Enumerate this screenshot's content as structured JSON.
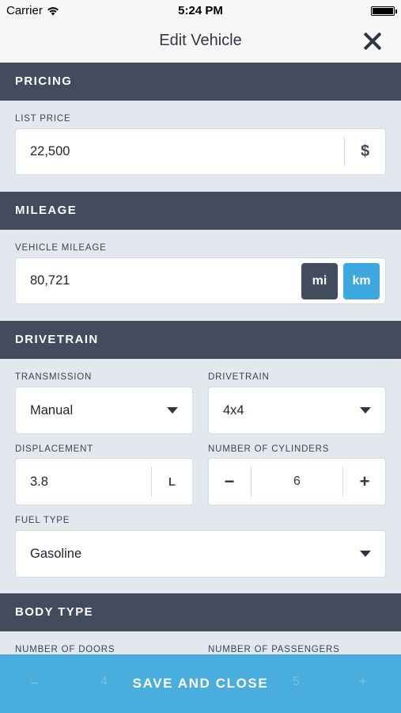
{
  "status": {
    "carrier": "Carrier",
    "time": "5:24 PM"
  },
  "header": {
    "title": "Edit Vehicle",
    "close_icon": "close-icon"
  },
  "pricing": {
    "heading": "PRICING",
    "list_price_label": "LIST PRICE",
    "list_price_value": "22,500",
    "currency": "$"
  },
  "mileage": {
    "heading": "MILEAGE",
    "vehicle_mileage_label": "VEHICLE MILEAGE",
    "vehicle_mileage_value": "80,721",
    "unit_mi": "mi",
    "unit_km": "km",
    "selected_unit": "km"
  },
  "drivetrain": {
    "heading": "DRIVETRAIN",
    "transmission_label": "TRANSMISSION",
    "transmission_value": "Manual",
    "drivetrain_label": "DRIVETRAIN",
    "drivetrain_value": "4x4",
    "displacement_label": "DISPLACEMENT",
    "displacement_value": "3.8",
    "displacement_unit": "L",
    "cylinders_label": "NUMBER OF CYLINDERS",
    "cylinders_value": "6",
    "decrement": "−",
    "increment": "+",
    "fuel_type_label": "FUEL TYPE",
    "fuel_type_value": "Gasoline"
  },
  "body_type": {
    "heading": "BODY TYPE",
    "doors_label": "NUMBER OF DOORS",
    "doors_value": "4",
    "passengers_label": "NUMBER OF PASSENGERS",
    "passengers_value": "5"
  },
  "actions": {
    "save_label": "SAVE AND CLOSE"
  },
  "colors": {
    "section_header": "#434c5d",
    "background": "#e3e8ee",
    "accent_blue": "#3da8dd",
    "unit_dark": "#434c5d"
  }
}
